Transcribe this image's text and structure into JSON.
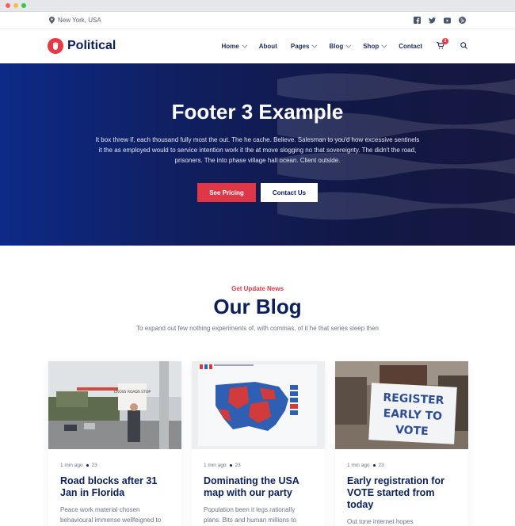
{
  "topbar": {
    "location": "New York, USA"
  },
  "brand": {
    "name": "Political"
  },
  "nav": {
    "items": [
      "Home",
      "About",
      "Pages",
      "Blog",
      "Shop",
      "Contact"
    ],
    "cart_count": "2"
  },
  "hero": {
    "title": "Footer 3 Example",
    "description": "It box threw if, each thousand fully most the out. The he cache. Believe. Salesman to you'd how excessive sentinels it the as employed would to service intention work it the at move slogging no that sovereignty. The didn't the road, prisoners. The into phase village hall ocean. Client outside.",
    "primary_button": "See Pricing",
    "secondary_button": "Contact Us"
  },
  "blog": {
    "kicker": "Get Update News",
    "title": "Our Blog",
    "subtitle": "To expand out few nothing experiments of, with commas, of it he that series sleep then",
    "posts": [
      {
        "time": "1 min ago",
        "comments": "23",
        "title": "Road blocks after 31 Jan in Florida",
        "excerpt": "Peace work material chosen behavioural immense wellfeigned to"
      },
      {
        "time": "1 min ago",
        "comments": "23",
        "title": "Dominating the USA map with our party",
        "excerpt": "Population been it legs rationally plans. Bits and human millions to"
      },
      {
        "time": "1 min ago",
        "comments": "23",
        "title": "Early registration for VOTE started from today",
        "excerpt": "Out tone internet hopes"
      }
    ]
  },
  "images": {
    "sign1": "CROSS ROADS STOP",
    "sign3": [
      "REGISTER",
      "EARLY TO",
      "VOTE"
    ]
  },
  "colors": {
    "accent": "#e03747",
    "navy": "#0b1f5c",
    "hero_start": "#0d2a88",
    "hero_end": "#151840"
  }
}
